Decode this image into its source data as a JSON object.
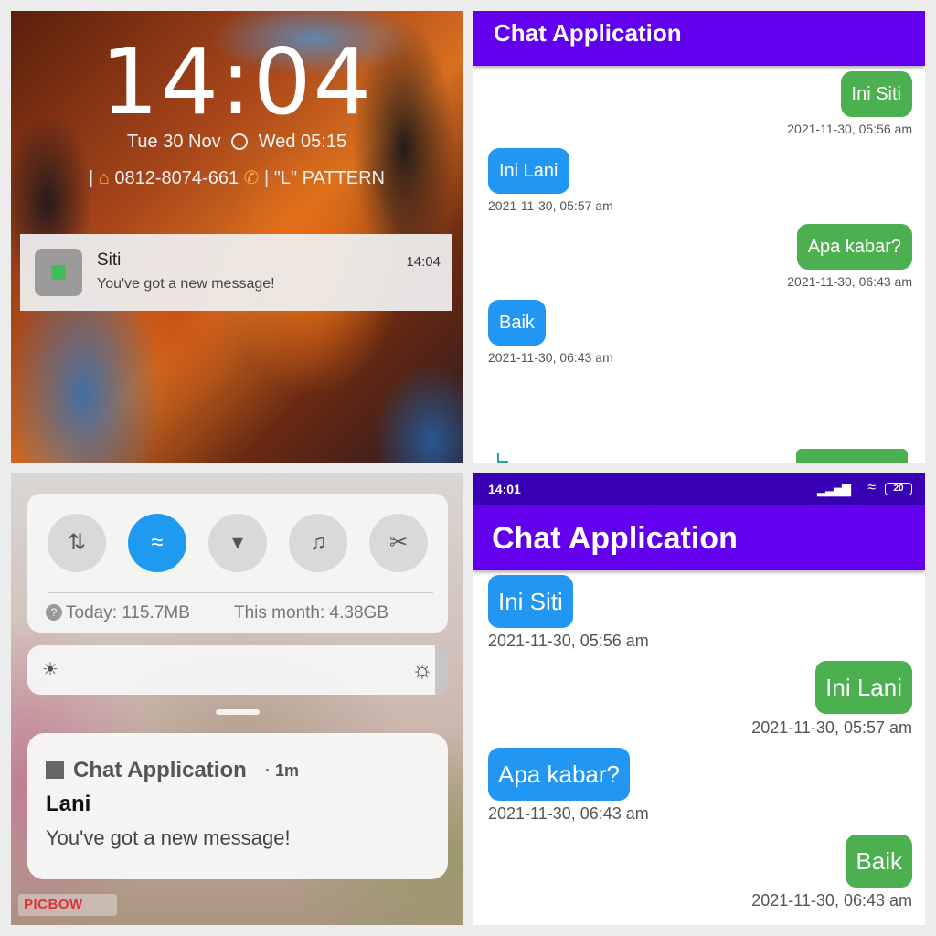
{
  "lock_screen": {
    "clock": "14:04",
    "date": "Tue 30 Nov",
    "alarm": "Wed 05:15",
    "owner_phone": "0812-8074-661",
    "pattern_hint": "\"L\" PATTERN",
    "notification": {
      "sender": "Siti",
      "message": "You've got a new message!",
      "time": "14:04"
    }
  },
  "chat_small": {
    "title": "Chat Application",
    "messages": [
      {
        "text": "Ini Siti",
        "time": "2021-11-30, 05:56 am",
        "side": "right",
        "color": "#4caf50"
      },
      {
        "text": "Ini Lani",
        "time": "2021-11-30, 05:57 am",
        "side": "left",
        "color": "#2196f3"
      },
      {
        "text": "Apa kabar?",
        "time": "2021-11-30, 06:43 am",
        "side": "right",
        "color": "#4caf50"
      },
      {
        "text": "Baik",
        "time": "2021-11-30, 06:43 am",
        "side": "left",
        "color": "#2196f3"
      }
    ]
  },
  "notification_shade": {
    "tiles": [
      "data-toggle-icon",
      "wifi-icon",
      "flashlight-icon",
      "bell-icon",
      "screenshot-icon"
    ],
    "usage_today": "Today: 115.7MB",
    "usage_month": "This month: 4.38GB",
    "notification": {
      "app": "Chat Application",
      "age": "· 1m",
      "sender": "Lani",
      "message": "You've got a new message!"
    },
    "watermark": "PICBOW"
  },
  "chat_large": {
    "status_time": "14:01",
    "battery": "20",
    "title": "Chat Application",
    "messages": [
      {
        "text": "Ini Siti",
        "time": "2021-11-30, 05:56 am",
        "side": "left",
        "color": "#2196f3"
      },
      {
        "text": "Ini Lani",
        "time": "2021-11-30, 05:57 am",
        "side": "right",
        "color": "#4caf50"
      },
      {
        "text": "Apa kabar?",
        "time": "2021-11-30, 06:43 am",
        "side": "left",
        "color": "#2196f3"
      },
      {
        "text": "Baik",
        "time": "2021-11-30, 06:43 am",
        "side": "right",
        "color": "#4caf50"
      }
    ]
  },
  "colors": {
    "app_bar": "#6200ee",
    "status_bar": "#3700b3",
    "bubble_green": "#4caf50",
    "bubble_blue": "#2196f3"
  }
}
